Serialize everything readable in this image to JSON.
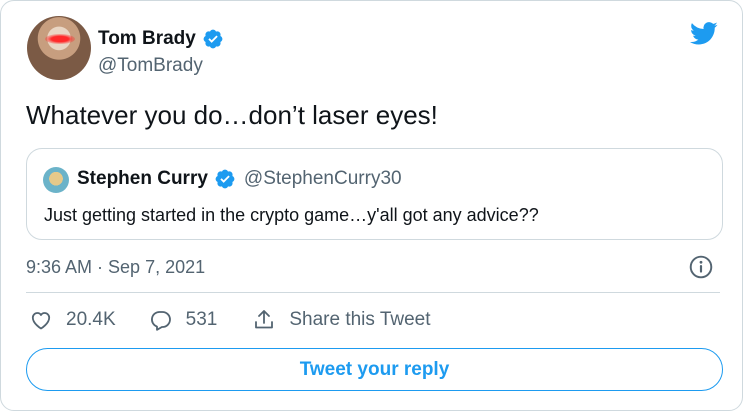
{
  "author": {
    "display_name": "Tom Brady",
    "handle": "@TomBrady",
    "verified": true
  },
  "tweet": {
    "text": "Whatever you do…don’t laser eyes!",
    "timestamp": "9:36 AM · Sep 7, 2021"
  },
  "quoted_tweet": {
    "display_name": "Stephen Curry",
    "handle": "@StephenCurry30",
    "verified": true,
    "text": "Just getting started in the crypto game…y'all got any advice??"
  },
  "actions": {
    "likes": "20.4K",
    "replies": "531",
    "share_label": "Share this Tweet"
  },
  "reply_button": {
    "label": "Tweet your reply"
  },
  "icons": {
    "brand": "twitter-bird-icon",
    "verified": "verified-badge-icon",
    "info": "info-icon",
    "like": "heart-icon",
    "reply": "reply-bubble-icon",
    "share": "share-icon"
  },
  "colors": {
    "accent": "#1d9bf0",
    "secondary_text": "#536471",
    "border": "#cfd9de",
    "text": "#0f1419"
  }
}
